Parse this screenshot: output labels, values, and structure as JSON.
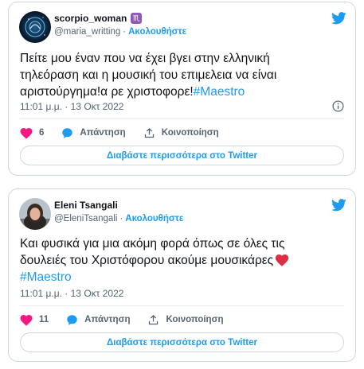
{
  "tweets": [
    {
      "user": {
        "name": "scorpio_woman",
        "badge": "♏",
        "handle": "@maria_writting",
        "follow_label": "Ακολουθήστε"
      },
      "text_lines": [
        "Πείτε μου έναν που να έχει βγει στην ελληνική",
        "τηλεόραση και η μουσική του επιμελεια να είναι",
        "αριστούργημα!α ρε χριστοφορε!"
      ],
      "hashtag": "#Maestro",
      "timestamp": "11:01 μ.μ. · 13 Οκτ 2022",
      "likes": "6",
      "reply_label": "Απάντηση",
      "share_label": "Κοινοποίηση",
      "read_more_label": "Διαβάστε περισσότερα στο Twitter"
    },
    {
      "user": {
        "name": "Eleni Tsangali",
        "handle": "@EleniTsangali",
        "follow_label": "Ακολουθήστε"
      },
      "text_lines": [
        "Και φυσικά για μια ακόμη φορά όπως σε όλες τις",
        "δουλειές του Χριστόφορου ακούμε μουσικάρες"
      ],
      "hashtag": "#Maestro",
      "timestamp": "11:01 μ.μ. · 13 Οκτ 2022",
      "likes": "11",
      "reply_label": "Απάντηση",
      "share_label": "Κοινοποίηση",
      "read_more_label": "Διαβάστε περισσότερα στο Twitter"
    }
  ],
  "colors": {
    "accent": "#1d9bf0",
    "like": "#f91880",
    "text": "#0f1419",
    "muted": "#536471",
    "border": "#cfd9de"
  },
  "icons": [
    "twitter-bird-icon",
    "info-icon",
    "heart-icon",
    "reply-bubble-icon",
    "share-icon"
  ]
}
